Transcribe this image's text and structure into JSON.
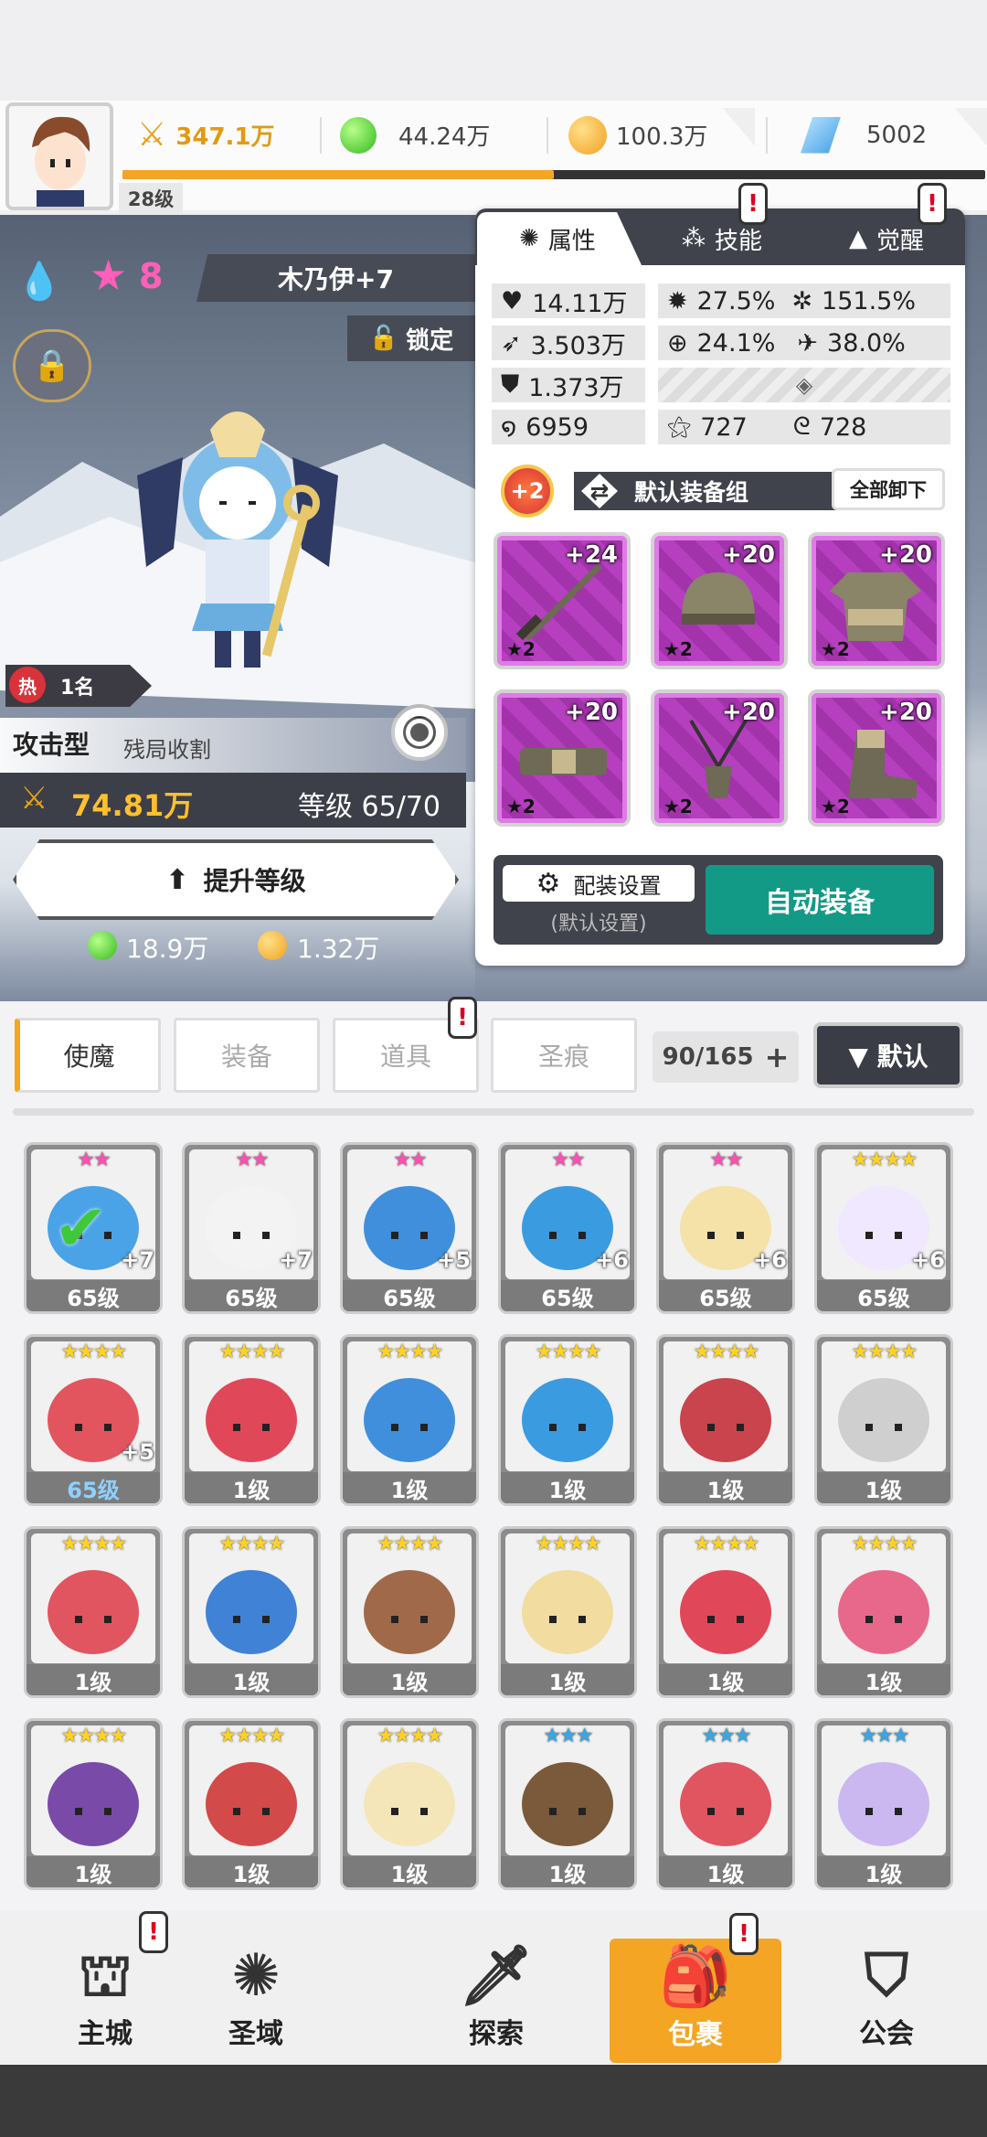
{
  "player": {
    "level": "28级",
    "power": "347.1万",
    "xp_progress": 0.5
  },
  "resources": [
    {
      "icon": "green-gem-icon",
      "value": "44.24万"
    },
    {
      "icon": "gold-coin-icon",
      "value": "100.3万"
    },
    {
      "icon": "blue-crystal-icon",
      "value": "5002"
    }
  ],
  "hero": {
    "element_icon": "water-drop-icon",
    "stars": "8",
    "name": "木乃伊+7",
    "lock_label": "锁定",
    "rank_label": "1名",
    "hot_label": "热",
    "type": "攻击型",
    "trait": "残局收割",
    "power": "74.81万",
    "level": "等级 65/70",
    "upgrade_label": "提升等级",
    "upgrade_cost_green": "18.9万",
    "upgrade_cost_gold": "1.32万"
  },
  "panel": {
    "tabs": [
      "属性",
      "技能",
      "觉醒"
    ],
    "stats": {
      "hp": "14.11万",
      "crit": "27.5%",
      "crit_dmg": "151.5%",
      "atk": "3.503万",
      "hit": "24.1%",
      "speed": "38.0%",
      "def": "1.373万",
      "s1": "6959",
      "s2": "727",
      "s3": "728"
    },
    "bonus": "+2",
    "equip_group": "默认装备组",
    "unequip_all": "全部卸下",
    "equip_slots": [
      {
        "type": "sword-icon",
        "plus": "+24",
        "star": "★2"
      },
      {
        "type": "helmet-icon",
        "plus": "+20",
        "star": "★2"
      },
      {
        "type": "armor-icon",
        "plus": "+20",
        "star": "★2"
      },
      {
        "type": "belt-icon",
        "plus": "+20",
        "star": "★2"
      },
      {
        "type": "necklace-icon",
        "plus": "+20",
        "star": "★2"
      },
      {
        "type": "boots-icon",
        "plus": "+20",
        "star": "★2"
      }
    ],
    "config_label": "配装设置",
    "config_sub": "(默认设置)",
    "auto_equip": "自动装备"
  },
  "inventory": {
    "tabs": [
      "使魔",
      "装备",
      "道具",
      "圣痕"
    ],
    "count": "90/165",
    "sort_label": "▼ 默认",
    "cards": [
      {
        "stars": "★★",
        "star_color": "#ff4fb0",
        "level": "65级",
        "plus": "+7",
        "color": "#4aa3e6",
        "check": true
      },
      {
        "stars": "★★",
        "star_color": "#ff4fb0",
        "level": "65级",
        "plus": "+7",
        "color": "#f3f3f3"
      },
      {
        "stars": "★★",
        "star_color": "#ff4fb0",
        "level": "65级",
        "plus": "+5",
        "color": "#3f8fdc"
      },
      {
        "stars": "★★",
        "star_color": "#ff4fb0",
        "level": "65级",
        "plus": "+6",
        "color": "#3b9be0"
      },
      {
        "stars": "★★",
        "star_color": "#ff4fb0",
        "level": "65级",
        "plus": "+6",
        "color": "#f5e2a8"
      },
      {
        "stars": "★★★★",
        "star_color": "#ffd21f",
        "level": "65级",
        "plus": "+6",
        "color": "#efe8ff"
      },
      {
        "stars": "★★★★",
        "star_color": "#ffd21f",
        "level": "65级",
        "plus": "+5",
        "color": "#e2555e",
        "lvl_blue": true
      },
      {
        "stars": "★★★★",
        "star_color": "#ffd21f",
        "level": "1级",
        "plus": "",
        "color": "#e0485a"
      },
      {
        "stars": "★★★★",
        "star_color": "#ffd21f",
        "level": "1级",
        "plus": "",
        "color": "#3f8fdc"
      },
      {
        "stars": "★★★★",
        "star_color": "#ffd21f",
        "level": "1级",
        "plus": "",
        "color": "#3b9be0"
      },
      {
        "stars": "★★★★",
        "star_color": "#ffd21f",
        "level": "1级",
        "plus": "",
        "color": "#c9444c"
      },
      {
        "stars": "★★★★",
        "star_color": "#ffd21f",
        "level": "1级",
        "plus": "",
        "color": "#cfcfcf"
      },
      {
        "stars": "★★★★",
        "star_color": "#ffd21f",
        "level": "1级",
        "plus": "",
        "color": "#e05560"
      },
      {
        "stars": "★★★★",
        "star_color": "#ffd21f",
        "level": "1级",
        "plus": "",
        "color": "#3f82d6"
      },
      {
        "stars": "★★★★",
        "star_color": "#ffd21f",
        "level": "1级",
        "plus": "",
        "color": "#a06a4a"
      },
      {
        "stars": "★★★★",
        "star_color": "#ffd21f",
        "level": "1级",
        "plus": "",
        "color": "#f2dca0"
      },
      {
        "stars": "★★★★",
        "star_color": "#ffd21f",
        "level": "1级",
        "plus": "",
        "color": "#e0485a"
      },
      {
        "stars": "★★★★",
        "star_color": "#ffd21f",
        "level": "1级",
        "plus": "",
        "color": "#e8688c"
      },
      {
        "stars": "★★★★",
        "star_color": "#ffd21f",
        "level": "1级",
        "plus": "",
        "color": "#7a4aa8"
      },
      {
        "stars": "★★★★",
        "star_color": "#ffd21f",
        "level": "1级",
        "plus": "",
        "color": "#d24a4a"
      },
      {
        "stars": "★★★★",
        "star_color": "#ffd21f",
        "level": "1级",
        "plus": "",
        "color": "#f4e6b8"
      },
      {
        "stars": "★★★",
        "star_color": "#37a6e8",
        "level": "1级",
        "plus": "",
        "color": "#7a5a3a"
      },
      {
        "stars": "★★★",
        "star_color": "#37a6e8",
        "level": "1级",
        "plus": "",
        "color": "#e05560"
      },
      {
        "stars": "★★★",
        "star_color": "#37a6e8",
        "level": "1级",
        "plus": "",
        "color": "#cbb8f0"
      }
    ]
  },
  "nav": [
    {
      "label": "主城",
      "icon": "castle-icon"
    },
    {
      "label": "圣域",
      "icon": "vortex-icon"
    },
    {
      "label": "探索",
      "icon": "sword-stone-icon"
    },
    {
      "label": "包裹",
      "icon": "bag-icon",
      "active": true
    },
    {
      "label": "公会",
      "icon": "guild-icon"
    }
  ],
  "colors": {
    "accent": "#f5a524",
    "teal": "#139a86",
    "active_nav": "#f5a524"
  }
}
